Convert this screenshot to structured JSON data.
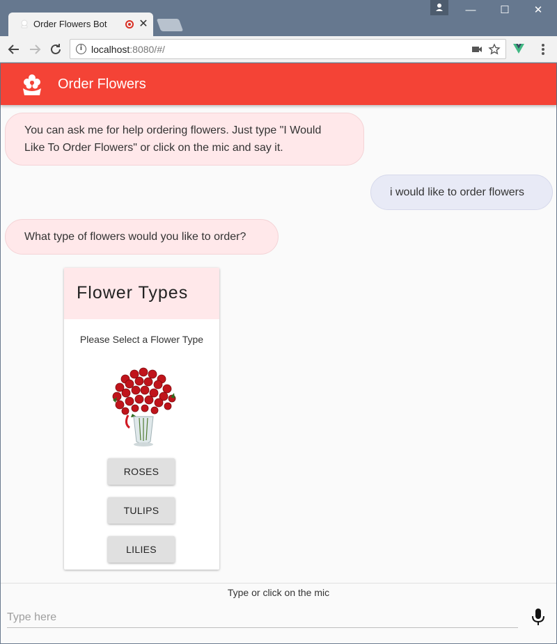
{
  "browser": {
    "tab_title": "Order Flowers Bot",
    "tab_close": "✕",
    "url_host": "localhost",
    "url_rest": ":8080/#/",
    "window_buttons": {
      "minimize": "—",
      "maximize": "☐",
      "close": "✕"
    }
  },
  "app": {
    "title": "Order Flowers",
    "accent_color": "#f44336",
    "bot_bubble_color": "#ffe8ea",
    "user_bubble_color": "#e8eaf6"
  },
  "messages": [
    {
      "from": "bot",
      "text": "You can ask me for help ordering flowers. Just type \"I Would Like To Order Flowers\" or click on the mic and say it."
    },
    {
      "from": "user",
      "text": "i would like to order flowers"
    },
    {
      "from": "bot",
      "text": "What type of flowers would you like to order?"
    }
  ],
  "card": {
    "title": "Flower Types",
    "subtitle": "Please Select a Flower Type",
    "image": "roses-bouquet-image",
    "buttons": [
      "ROSES",
      "TULIPS",
      "LILIES"
    ]
  },
  "input": {
    "hint": "Type or click on the mic",
    "placeholder": "Type here",
    "mic_icon": "mic-icon"
  }
}
